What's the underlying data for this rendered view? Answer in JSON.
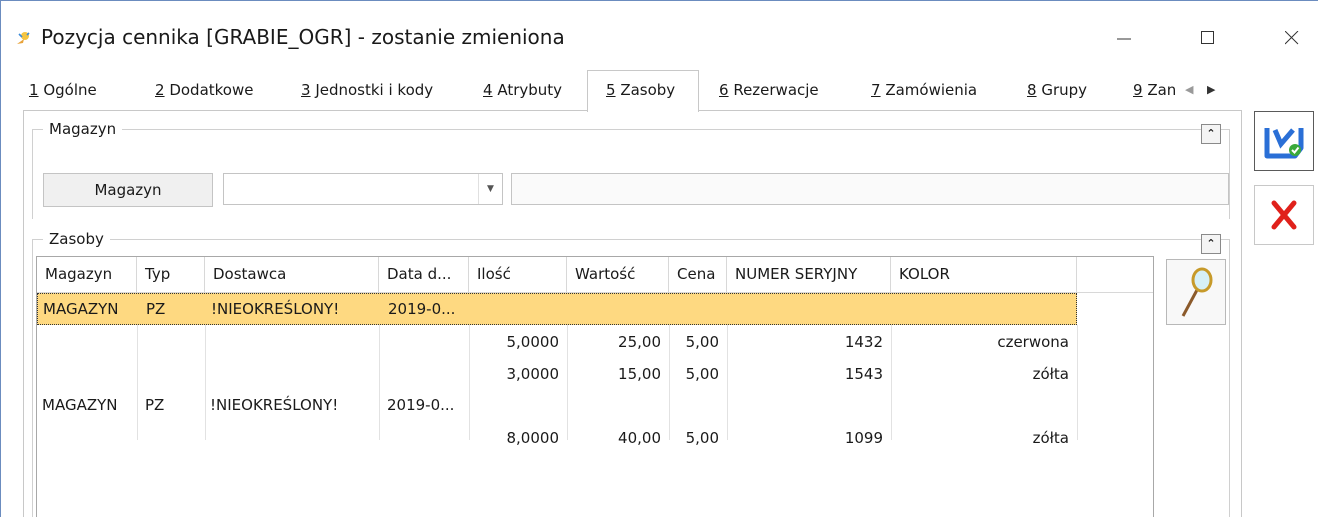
{
  "window": {
    "title": "Pozycja cennika [GRABIE_OGR] - zostanie zmieniona"
  },
  "tabs": [
    {
      "key": "1",
      "label": " Ogólne"
    },
    {
      "key": "2",
      "label": " Dodatkowe"
    },
    {
      "key": "3",
      "label": " Jednostki i kody"
    },
    {
      "key": "4",
      "label": " Atrybuty"
    },
    {
      "key": "5",
      "label": " Zasoby",
      "active": true
    },
    {
      "key": "6",
      "label": " Rezerwacje"
    },
    {
      "key": "7",
      "label": " Zamówienia"
    },
    {
      "key": "8",
      "label": " Grupy"
    },
    {
      "key": "9",
      "label": " Zan"
    }
  ],
  "magazyn_group": {
    "title": "Magazyn",
    "button_label": "Magazyn",
    "combo_value": "",
    "description_value": ""
  },
  "zasoby_group": {
    "title": "Zasoby"
  },
  "grid": {
    "columns": [
      "Magazyn",
      "Typ",
      "Dostawca",
      "Data d...",
      "Ilość",
      "Wartość",
      "Cena",
      "NUMER SERYJNY",
      "KOLOR"
    ],
    "selected_row": {
      "magazyn": "MAGAZYN",
      "typ": "PZ",
      "dostawca": "!NIEOKREŚLONY!",
      "data": "2019-0..."
    },
    "group_row": {
      "magazyn": "MAGAZYN",
      "typ": "PZ",
      "dostawca": "!NIEOKREŚLONY!",
      "data": "2019-0..."
    },
    "detail_rows": [
      {
        "ilosc": "5,0000",
        "wartosc": "25,00",
        "cena": "5,00",
        "numer": "1432",
        "kolor": "czerwona"
      },
      {
        "ilosc": "3,0000",
        "wartosc": "15,00",
        "cena": "5,00",
        "numer": "1543",
        "kolor": "zółta"
      },
      {
        "ilosc": "8,0000",
        "wartosc": "40,00",
        "cena": "5,00",
        "numer": "1099",
        "kolor": "zółta"
      }
    ]
  },
  "colors": {
    "selection": "#fed981",
    "save_blue": "#2a6fd6",
    "cancel_red": "#e0211b"
  }
}
